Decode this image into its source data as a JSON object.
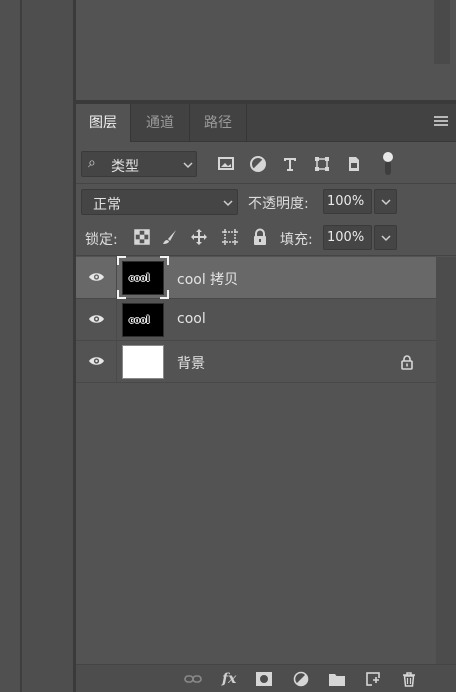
{
  "tabs": [
    {
      "label": "图层",
      "active": true
    },
    {
      "label": "通道",
      "active": false
    },
    {
      "label": "路径",
      "active": false
    }
  ],
  "filter": {
    "type_label": "类型"
  },
  "blend": {
    "mode": "正常",
    "opacity_label": "不透明度:",
    "opacity_value": "100%"
  },
  "lock": {
    "label": "锁定:",
    "fill_label": "填充:",
    "fill_value": "100%"
  },
  "layers": [
    {
      "name": "cool 拷贝",
      "thumb_text": "cool",
      "selected": true,
      "visible": true,
      "locked": false
    },
    {
      "name": "cool",
      "thumb_text": "cool",
      "selected": false,
      "visible": true,
      "locked": false
    },
    {
      "name": "背景",
      "thumb_text": "",
      "selected": false,
      "visible": true,
      "locked": true
    }
  ],
  "icons": {
    "filter": [
      "image-filter-icon",
      "adjustment-filter-icon",
      "type-filter-icon",
      "shape-filter-icon",
      "smart-object-filter-icon",
      "filter-toggle-icon"
    ],
    "lock": [
      "lock-transparent-pixels-icon",
      "lock-image-pixels-icon",
      "lock-position-icon",
      "lock-artboard-icon",
      "lock-all-icon"
    ],
    "bottom": [
      "link-layers-icon",
      "fx-icon",
      "add-mask-icon",
      "new-adjustment-layer-icon",
      "new-group-icon",
      "new-layer-icon",
      "delete-layer-icon"
    ]
  },
  "colors": {
    "panel_bg": "#535353",
    "selected_layer": "#686868",
    "tab_bar": "#424242"
  }
}
